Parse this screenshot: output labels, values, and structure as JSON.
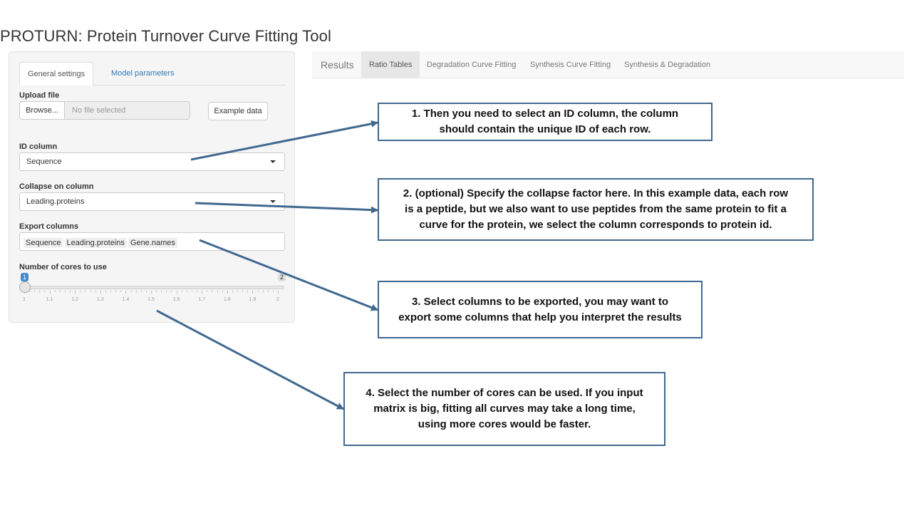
{
  "app": {
    "title": "PROTURN: Protein Turnover Curve Fitting Tool"
  },
  "sidebar": {
    "tabs": [
      {
        "label": "General settings"
      },
      {
        "label": "Model parameters"
      }
    ],
    "upload": {
      "label": "Upload file",
      "browse_label": "Browse...",
      "file_placeholder": "No file selected",
      "example_label": "Example data"
    },
    "id_column": {
      "label": "ID column",
      "value": "Sequence"
    },
    "collapse": {
      "label": "Collapse on column",
      "value": "Leading.proteins"
    },
    "export": {
      "label": "Export columns",
      "chips": [
        "Sequence",
        "Leading.proteins",
        "Gene.names"
      ]
    },
    "cores": {
      "label": "Number of cores to use",
      "min_label": "1",
      "max_label": "2",
      "value": 1,
      "ticks": [
        "1",
        "1.1",
        "1.2",
        "1.3",
        "1.4",
        "1.5",
        "1.6",
        "1.7",
        "1.8",
        "1.9",
        "2"
      ]
    }
  },
  "navbar": {
    "brand": "Results",
    "tabs": [
      {
        "label": "Ratio Tables"
      },
      {
        "label": "Degradation Curve Fitting"
      },
      {
        "label": "Synthesis Curve Fitting"
      },
      {
        "label": "Synthesis & Degradation"
      }
    ]
  },
  "callouts": [
    {
      "lines": [
        "1. Then you need to select an ID column, the column",
        "should contain the unique ID of each row."
      ]
    },
    {
      "lines": [
        "2. (optional) Specify the collapse factor here. In this example data, each row",
        "is a peptide, but we also want to use peptides from the same protein to fit a",
        "curve for the protein, we select the column corresponds to protein id."
      ]
    },
    {
      "lines": [
        "3. Select columns to be exported, you may want to",
        "export some columns that help you interpret the results"
      ]
    },
    {
      "lines": [
        "4. Select the number of cores can be used. If you input",
        "matrix is big, fitting all curves may take a long time,",
        "using more cores would be faster."
      ]
    }
  ],
  "colors": {
    "arrow": "#41698f",
    "link": "#337ab7",
    "slider_accent": "#428bca"
  }
}
